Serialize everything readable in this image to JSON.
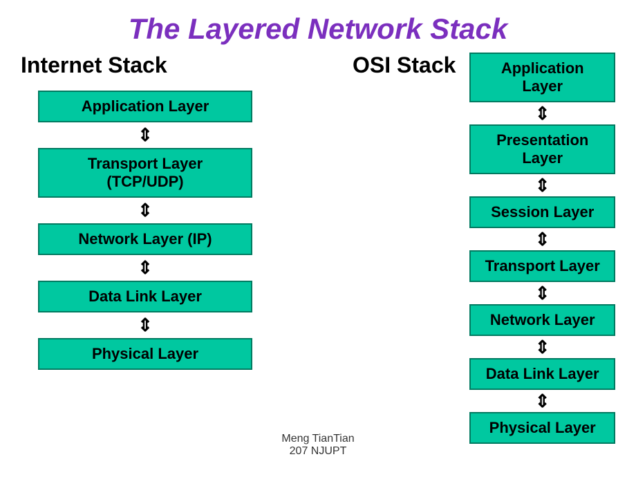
{
  "title": "The Layered Network Stack",
  "internetStack": {
    "title": "Internet Stack",
    "layers": [
      "Application Layer",
      "Transport Layer (TCP/UDP)",
      "Network Layer (IP)",
      "Data Link Layer",
      "Physical Layer"
    ]
  },
  "osiStack": {
    "title": "OSI Stack",
    "layers": [
      "Application Layer",
      "Presentation Layer",
      "Session Layer",
      "Transport Layer",
      "Network Layer",
      "Data Link Layer",
      "Physical Layer"
    ]
  },
  "watermark": {
    "line1": "Meng  TianTian",
    "line2": "207 NJUPT"
  },
  "arrow": "⇕"
}
